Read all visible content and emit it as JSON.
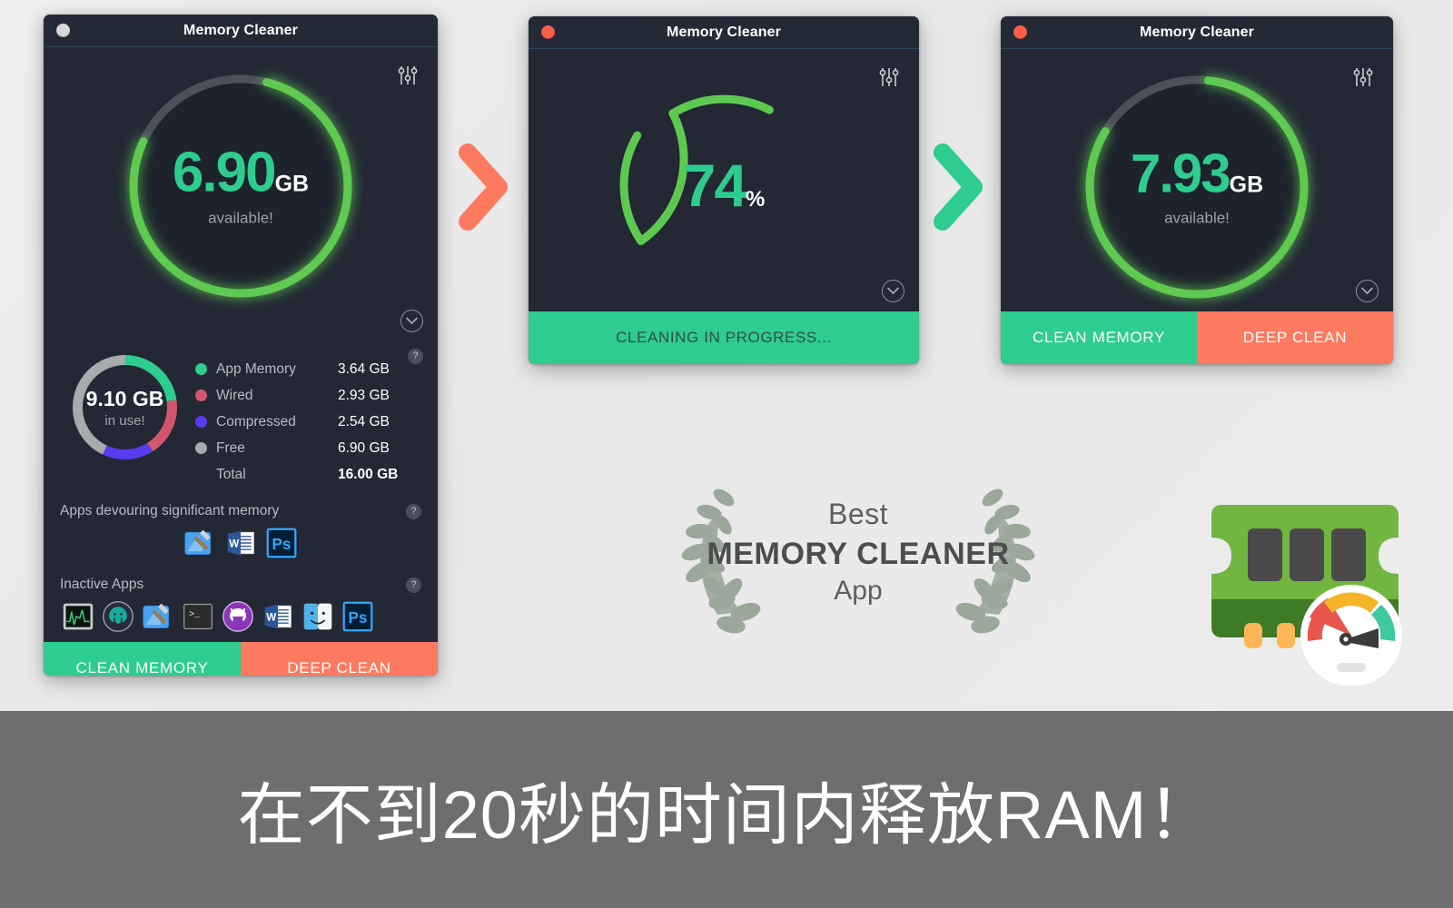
{
  "app": {
    "window_title": "Memory Cleaner",
    "accent_green": "#2ecc8f",
    "accent_green_bright": "#5ec951",
    "accent_red": "#fd7a60",
    "window_bg": "#232834"
  },
  "window_idle": {
    "title": "Memory Cleaner",
    "close_dot": "close-dot-inactive",
    "gauge": {
      "value": "6.90",
      "unit": "GB",
      "sub": "available!",
      "ring_percent": 78
    },
    "usage": {
      "center_value": "9.10 GB",
      "center_sub": "in use!",
      "legend": [
        {
          "label": "App Memory",
          "value": "3.64 GB",
          "color": "#2ecc8f"
        },
        {
          "label": "Wired",
          "value": "2.93 GB",
          "color": "#d1566d"
        },
        {
          "label": "Compressed",
          "value": "2.54 GB",
          "color": "#5a3cf0"
        },
        {
          "label": "Free",
          "value": "6.90 GB",
          "color": "#a8aaad"
        }
      ],
      "total_label": "Total",
      "total_value": "16.00 GB",
      "help": "?"
    },
    "devouring": {
      "title": "Apps devouring significant memory",
      "help": "?",
      "apps": [
        "xcode-icon",
        "microsoft-word-icon",
        "photoshop-icon"
      ]
    },
    "inactive": {
      "title": "Inactive Apps",
      "help": "?",
      "apps": [
        "activity-monitor-icon",
        "gitkraken-icon",
        "xcode-icon",
        "terminal-icon",
        "github-desktop-icon",
        "microsoft-word-icon",
        "finder-icon",
        "photoshop-icon"
      ]
    },
    "buttons": {
      "clean": "CLEAN MEMORY",
      "deep": "DEEP CLEAN"
    }
  },
  "window_cleaning": {
    "title": "Memory Cleaner",
    "close_dot": "close-dot-active",
    "gauge": {
      "value": "74",
      "unit": "%",
      "segments": 3
    },
    "status": "CLEANING IN PROGRESS..."
  },
  "window_done": {
    "title": "Memory Cleaner",
    "close_dot": "close-dot-active",
    "gauge": {
      "value": "7.93",
      "unit": "GB",
      "sub": "available!",
      "ring_percent": 82
    },
    "buttons": {
      "clean": "CLEAN MEMORY",
      "deep": "DEEP CLEAN"
    }
  },
  "arrows": [
    {
      "name": "arrow-step-1",
      "color": "#fd7a60"
    },
    {
      "name": "arrow-step-2",
      "color": "#2ecc8f"
    }
  ],
  "award": {
    "line1": "Best",
    "line2": "MEMORY CLEANER",
    "line3": "App"
  },
  "app_icon": {
    "name": "ram-chip-gauge-icon"
  },
  "caption": {
    "text": "在不到20秒的时间内释放RAM！"
  }
}
